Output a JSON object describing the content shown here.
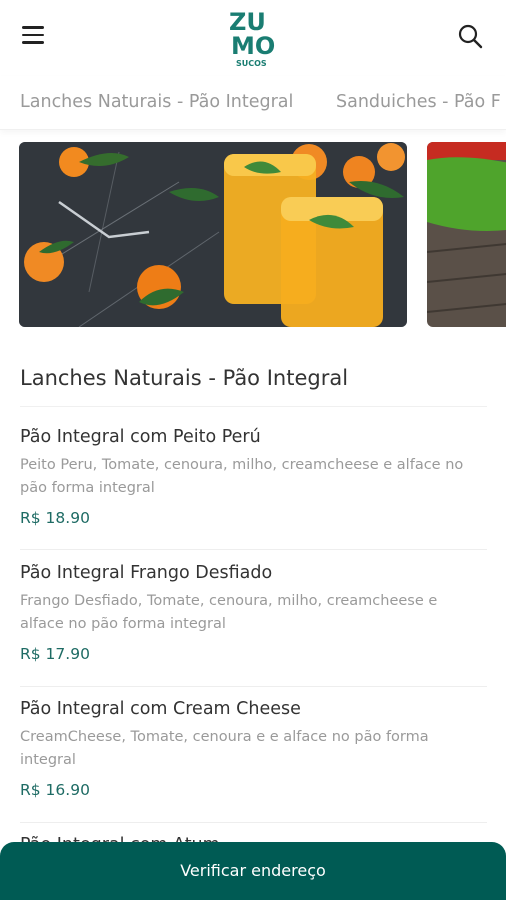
{
  "header": {
    "logo_text_top": "ZU",
    "logo_text_bottom": "MO",
    "logo_subtext": "SUCOS",
    "menu_icon": "hamburger-icon",
    "search_icon": "search-icon"
  },
  "tabs": [
    {
      "label": "Lanches Naturais - Pão Integral"
    },
    {
      "label": "Sanduiches - Pão F"
    }
  ],
  "section": {
    "title": "Lanches Naturais - Pão Integral"
  },
  "items": [
    {
      "name": "Pão Integral com Peito Perú",
      "desc_line1": "Peito Peru, Tomate, cenoura, milho, creamcheese e alface no",
      "desc_line2": "pão forma integral",
      "price": "R$ 18.90"
    },
    {
      "name": "Pão Integral Frango Desfiado",
      "desc_line1": "Frango Desfiado, Tomate, cenoura, milho, creamcheese e",
      "desc_line2": "alface no pão forma integral",
      "price": "R$ 17.90"
    },
    {
      "name": "Pão Integral com Cream Cheese",
      "desc_line1": "CreamCheese, Tomate, cenoura e e alface no pão forma",
      "desc_line2": "integral",
      "price": "R$ 16.90"
    },
    {
      "name": "Pão Integral com Atum"
    }
  ],
  "cta": {
    "label": "Verificar endereço"
  },
  "colors": {
    "brand": "#005b54",
    "price": "#1e6b64",
    "logo": "#1a7d72"
  }
}
